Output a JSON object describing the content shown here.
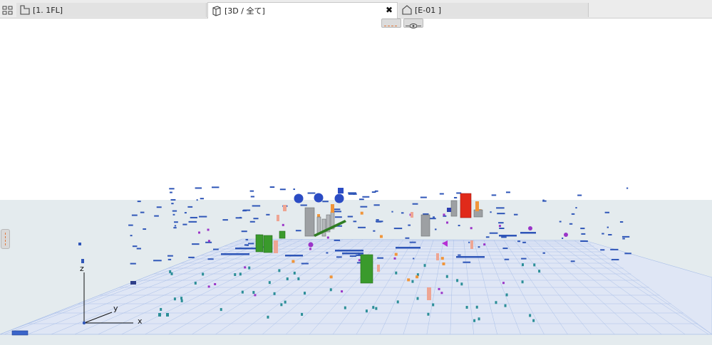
{
  "tabs": [
    {
      "label": "[1. 1FL]",
      "icon": "floor-plan-icon",
      "active": false
    },
    {
      "label": "[3D / 全て]",
      "icon": "3d-cube-icon",
      "active": true
    },
    {
      "label": "[E-01 ]",
      "icon": "elevation-icon",
      "active": false
    }
  ],
  "close_glyph": "✖",
  "axes": {
    "x": "x",
    "y": "y",
    "z": "z"
  },
  "colors": {
    "ground": "#e4ebee",
    "grid_fill": "#dfe6f5",
    "grid_line": "#a9bfe8",
    "accent_blue": "#2f56b8",
    "green": "#3a9a2c",
    "red": "#e02a1a",
    "gray": "#9da0a3",
    "salmon": "#eea593",
    "purple": "#9a34c8",
    "teal": "#2c8f98",
    "orange": "#f0953a"
  }
}
